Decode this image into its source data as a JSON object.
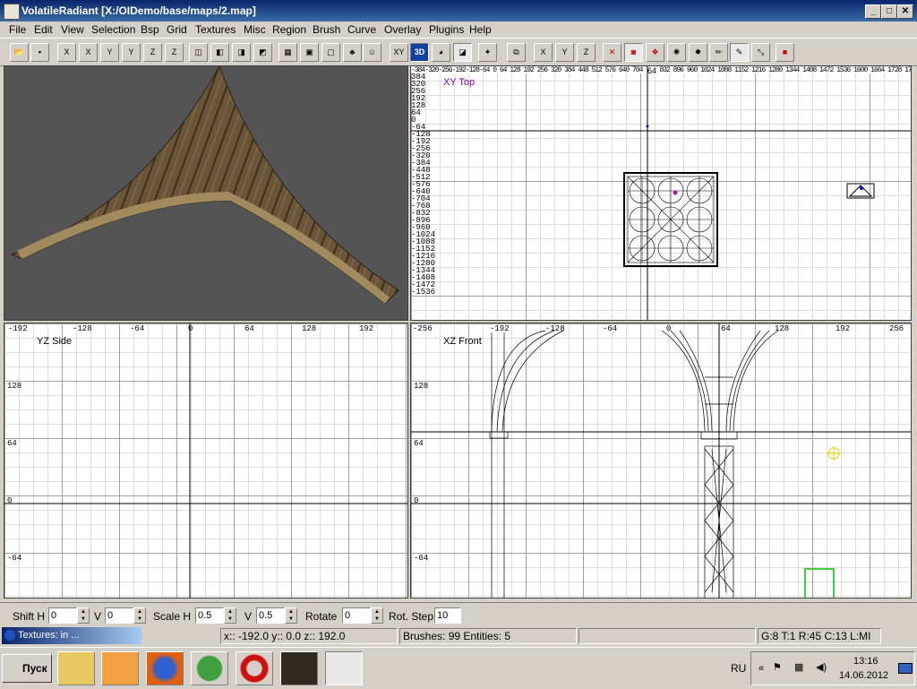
{
  "window": {
    "title": "VolatileRadiant [X:/OIDemo/base/maps/2.map]",
    "minimize": "_",
    "maximize": "□",
    "close": "✕"
  },
  "menu": [
    "File",
    "Edit",
    "View",
    "Selection",
    "Bsp",
    "Grid",
    "Textures",
    "Misc",
    "Region",
    "Brush",
    "Curve",
    "Overlay",
    "Plugins",
    "Help"
  ],
  "toolbar": {
    "xy_label": "XY",
    "3d_label": "3D",
    "x_label": "X",
    "y_label": "Y",
    "z_label": "Z"
  },
  "views": {
    "xy": {
      "label": "XY Top",
      "ruler_y": [
        "384",
        "320",
        "256",
        "192",
        "128",
        "64",
        "0",
        "-64",
        "-128",
        "-192",
        "-256",
        "-320",
        "-384",
        "-448",
        "-512",
        "-576",
        "-640",
        "-704",
        "-768",
        "-832",
        "-896",
        "-960",
        "-1024",
        "-1088",
        "-1152",
        "-1216",
        "-1280",
        "-1344",
        "-1408",
        "-1472",
        "-1536"
      ],
      "ruler_x_center": "64"
    },
    "yz": {
      "label": "YZ Side",
      "ruler_x": [
        "-192",
        "-128",
        "-64",
        "0",
        "64",
        "128",
        "192"
      ],
      "ruler_y": [
        "128",
        "64",
        "0",
        "-64"
      ]
    },
    "xz": {
      "label": "XZ Front",
      "ruler_x": [
        "-256",
        "-192",
        "-128",
        "-64",
        "0",
        "64",
        "128",
        "192",
        "256"
      ],
      "ruler_y": [
        "128",
        "64",
        "0",
        "-64"
      ]
    }
  },
  "surface": {
    "shift_h_label": "Shift H",
    "shift_h": "0",
    "shift_v_label": "V",
    "shift_v": "0",
    "scale_h_label": "Scale H",
    "scale_h": "0.5",
    "scale_v_label": "V",
    "scale_v": "0.5",
    "rotate_label": "Rotate",
    "rotate": "0",
    "rot_step_label": "Rot. Step",
    "rot_step": "10"
  },
  "status": {
    "textures_tab": "Textures: in ...",
    "coords": "x:: -192.0  y:: 0.0  z:: 192.0",
    "counts": "Brushes: 99 Entities: 5",
    "grid_info": "G:8 T:1 R:45 C:13 L:MI"
  },
  "taskbar": {
    "start": "Пуск",
    "lang": "RU",
    "time": "13:16",
    "date": "14.06.2012",
    "apps": [
      "file-manager",
      "media-player",
      "firefox",
      "utorrent",
      "opera",
      "radiant-tool",
      "game-app"
    ]
  }
}
